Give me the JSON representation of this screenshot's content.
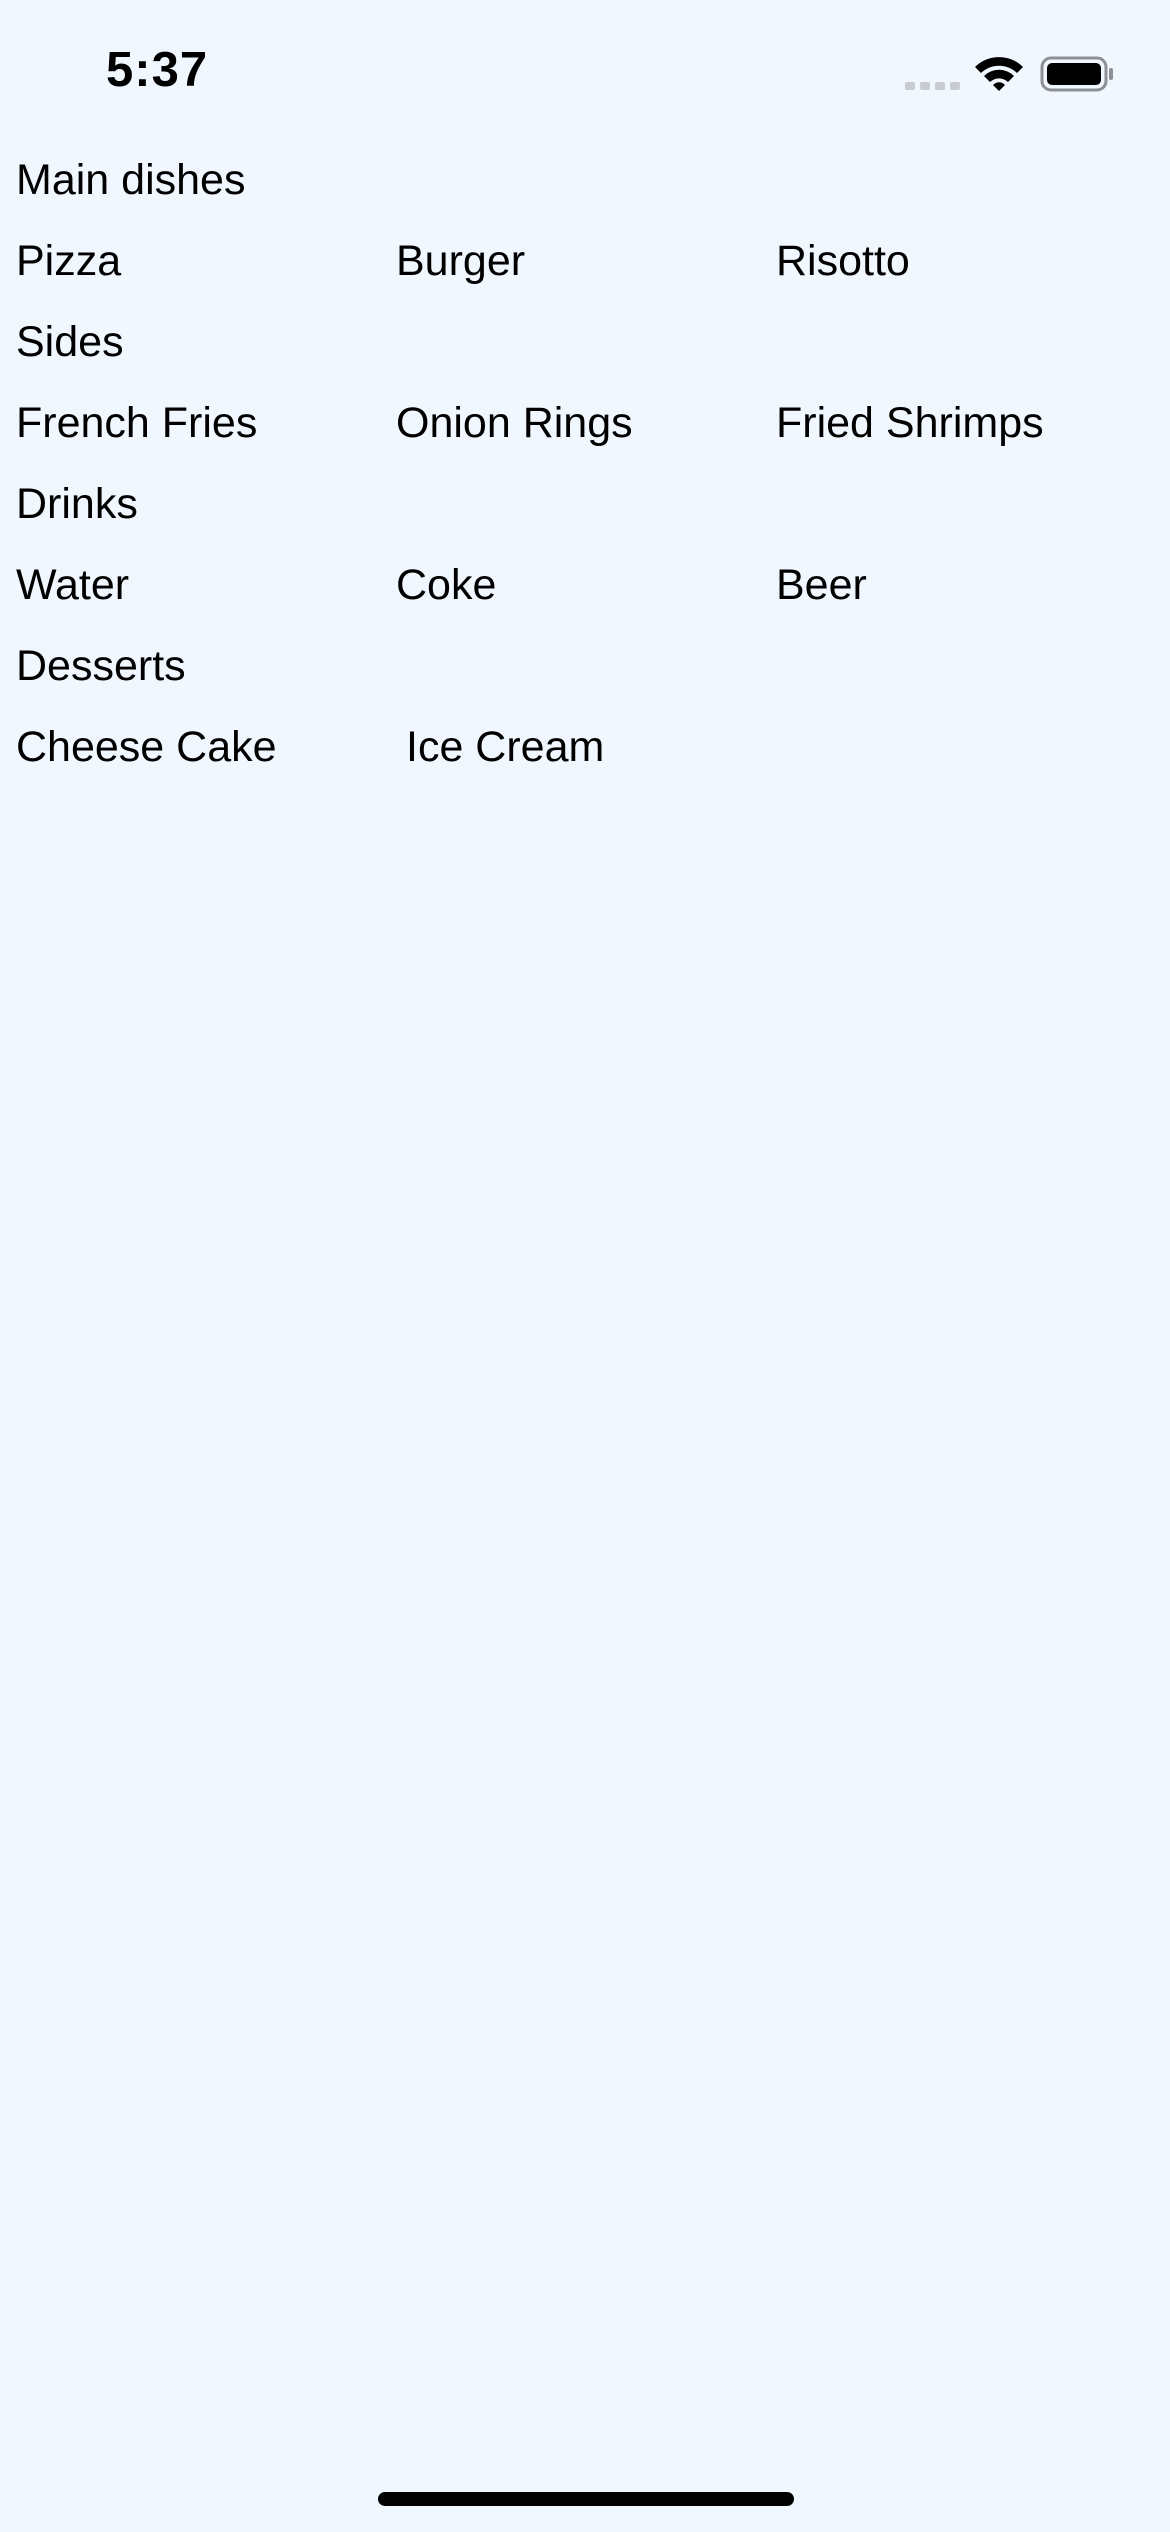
{
  "status_bar": {
    "time": "5:37"
  },
  "menu": {
    "sections": [
      {
        "title": "Main dishes",
        "items": [
          "Pizza",
          "Burger",
          "Risotto"
        ]
      },
      {
        "title": "Sides",
        "items": [
          "French Fries",
          "Onion Rings",
          "Fried Shrimps"
        ]
      },
      {
        "title": "Drinks",
        "items": [
          "Water",
          "Coke",
          "Beer"
        ]
      },
      {
        "title": "Desserts",
        "items": [
          "Cheese Cake",
          "Ice Cream"
        ]
      }
    ]
  },
  "colors": {
    "background": "#f0f7ff",
    "text": "#000000"
  }
}
